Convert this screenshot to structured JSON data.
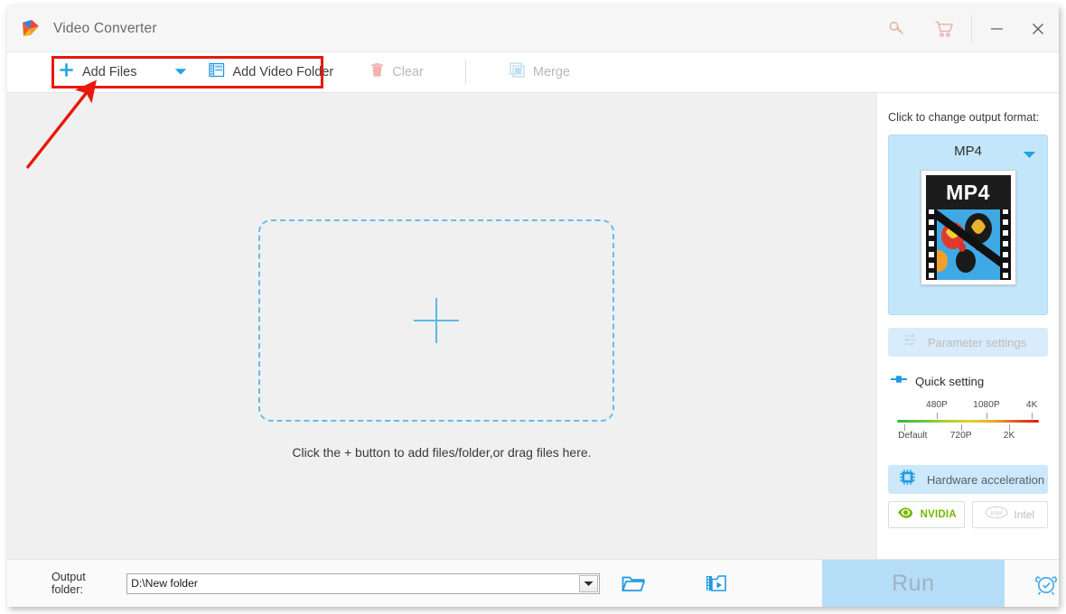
{
  "window": {
    "title": "Video Converter",
    "logo_icon": "app-logo-play-icon",
    "key_icon": "key-icon",
    "cart_icon": "cart-icon",
    "minimize_label": "minimize-icon",
    "close_label": "close-icon"
  },
  "toolbar": {
    "add_files_label": "Add Files",
    "add_files_icon": "plus-icon",
    "dropdown_icon": "caret-down-icon",
    "add_video_folder_label": "Add Video Folder",
    "add_video_folder_icon": "film-folder-icon",
    "clear_label": "Clear",
    "clear_icon": "trash-icon",
    "merge_label": "Merge",
    "merge_icon": "merge-squares-icon"
  },
  "stage": {
    "plus_icon": "plus-large-icon",
    "hint": "Click the + button to add files/folder,or drag files here."
  },
  "right_panel": {
    "title": "Click to change output format:",
    "format": {
      "name": "MP4",
      "caret_icon": "caret-down-icon",
      "thumb_label": "MP4"
    },
    "parameter_settings": {
      "label": "Parameter settings",
      "icon": "sliders-icon",
      "enabled": false
    },
    "quick_setting": {
      "label": "Quick setting",
      "icon": "slider-handle-icon",
      "top_labels": [
        "480P",
        "1080P",
        "4K"
      ],
      "bottom_labels": [
        "Default",
        "720P",
        "2K"
      ]
    },
    "hardware": {
      "label": "Hardware acceleration",
      "icon": "cpu-chip-icon",
      "nvidia_label": "NVIDIA",
      "nvidia_icon": "nvidia-eye-icon",
      "intel_label": "Intel",
      "intel_icon": "intel-logo-icon"
    }
  },
  "bottom": {
    "output_folder_label": "Output folder:",
    "output_folder_value": "D:\\New folder",
    "output_folder_caret_icon": "caret-down-icon",
    "open_folder_icon": "folder-open-icon",
    "media_folder_icon": "video-folder-icon",
    "run_label": "Run",
    "alarm_icon": "alarm-clock-icon"
  },
  "annotation": {
    "highlight_target": "add-files-group",
    "arrow_color": "#e8180c"
  },
  "colors": {
    "accent_blue": "#2196e8",
    "panel_blue": "#c3e6fa",
    "highlight_red": "#e8180c",
    "run_bg": "#b6ddf7"
  }
}
